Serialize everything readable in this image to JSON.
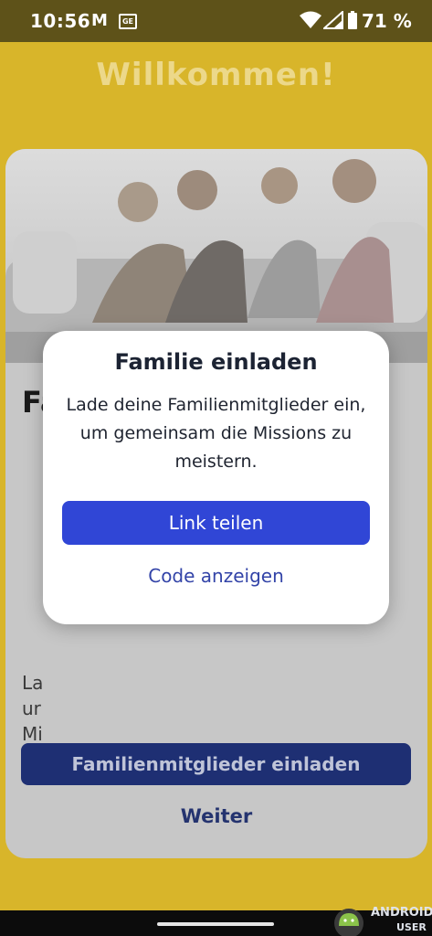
{
  "status_bar": {
    "time": "10:56",
    "battery": "71 %",
    "icons": [
      "gmail-icon",
      "ge-icon",
      "wifi-icon",
      "signal-icon",
      "battery-icon"
    ]
  },
  "background": {
    "title": "Willkommen!",
    "card_heading_partial": "Fa",
    "card_text_lines": [
      "La",
      "ur",
      "Mi"
    ],
    "primary_button": "Familienmitglieder einladen",
    "secondary_link": "Weiter"
  },
  "dialog": {
    "title": "Familie einladen",
    "body": "Lade deine Familienmitglieder ein, um gemeinsam die Missions zu meistern.",
    "primary_button": "Link teilen",
    "secondary_button": "Code anzeigen"
  },
  "watermark": {
    "line1": "ANDROID",
    "line2": "USER"
  },
  "colors": {
    "accent": "#3046d6",
    "background_dimmed": "#d8b52a",
    "status_bar": "#5e5219"
  }
}
